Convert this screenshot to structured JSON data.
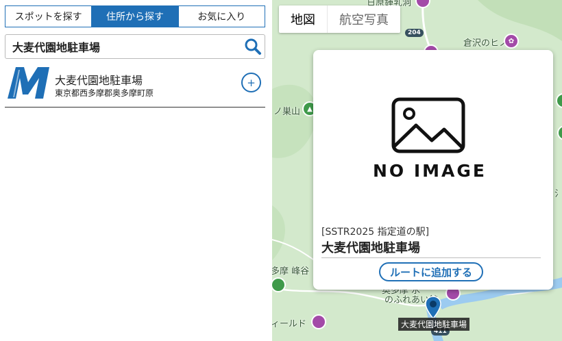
{
  "tabs": [
    {
      "label": "スポットを探す",
      "active": false
    },
    {
      "label": "住所から探す",
      "active": true
    },
    {
      "label": "お気に入り",
      "active": false
    }
  ],
  "search": {
    "value": "大麦代園地駐車場",
    "icon": "search-icon"
  },
  "result": {
    "logo": "M-logo",
    "name": "大麦代園地駐車場",
    "address": "東京都西多摩郡奥多摩町原",
    "add_label": "+"
  },
  "map": {
    "type_buttons": [
      {
        "label": "地図",
        "active": true
      },
      {
        "label": "航空写真",
        "active": false
      }
    ],
    "labels": {
      "top_left": "日原鍾乳洞",
      "hinoki": "倉沢のヒノキ",
      "nosu": "ノ巣山",
      "mine": "多摩 峰谷",
      "field": "ィールド",
      "fureai": "のふれあい館",
      "okutama": "奥多摩 水",
      "right_edge": "氵"
    },
    "road": "204",
    "road2": "411"
  },
  "popup": {
    "no_image": "NO IMAGE",
    "category": "[SSTR2025 指定道の駅]",
    "title": "大麦代園地駐車場",
    "route_button": "ルートに追加する"
  },
  "marker_label": "大麦代園地駐車場",
  "colors": {
    "accent": "#1f6fb6",
    "map_green": "#d3e9cc",
    "poi_purple": "#a34aa8",
    "poi_green": "#3f9a4a",
    "water": "#9ccbf0"
  }
}
